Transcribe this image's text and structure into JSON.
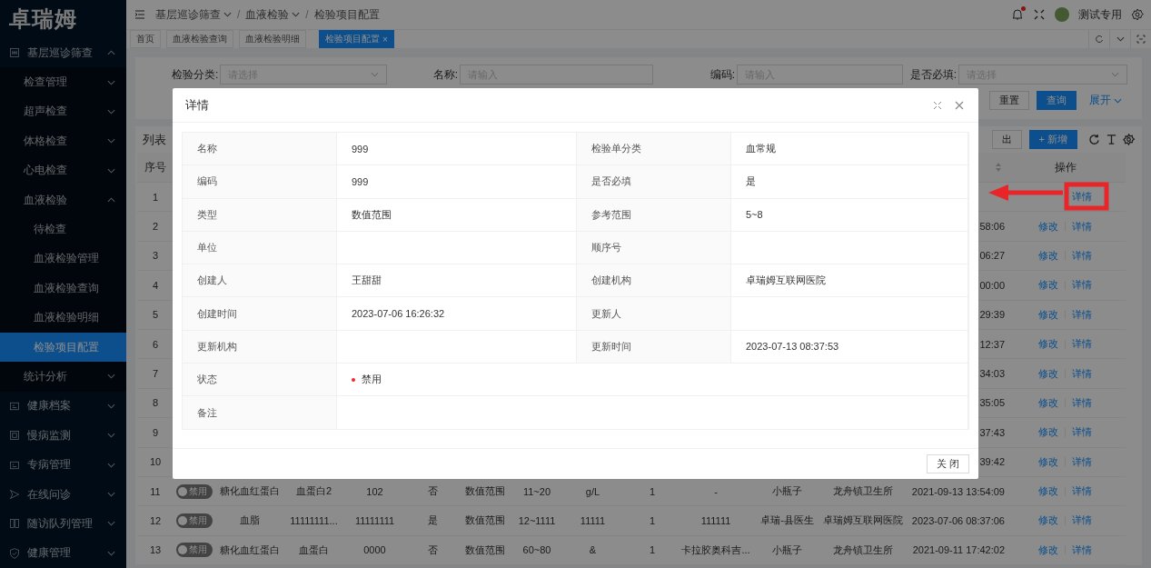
{
  "sidebar": {
    "logo": "卓瑞姆",
    "items": [
      {
        "label": "基层巡诊筛查",
        "expanded": true,
        "selected": false,
        "children": [
          {
            "label": "检查管理",
            "expanded": false,
            "selected": false
          },
          {
            "label": "超声检查",
            "expanded": false,
            "selected": false
          },
          {
            "label": "体格检查",
            "expanded": false,
            "selected": false
          },
          {
            "label": "心电检查",
            "expanded": false,
            "selected": false
          },
          {
            "label": "血液检验",
            "expanded": true,
            "selected": false,
            "children": [
              {
                "label": "待检查",
                "selected": false
              },
              {
                "label": "血液检验管理",
                "selected": false
              },
              {
                "label": "血液检验查询",
                "selected": false
              },
              {
                "label": "血液检验明细",
                "selected": false
              },
              {
                "label": "检验项目配置",
                "selected": true
              }
            ]
          },
          {
            "label": "统计分析",
            "expanded": false,
            "selected": false
          }
        ]
      },
      {
        "label": "健康档案",
        "expanded": false,
        "selected": false
      },
      {
        "label": "慢病监测",
        "expanded": false,
        "selected": false
      },
      {
        "label": "专病管理",
        "expanded": false,
        "selected": false
      },
      {
        "label": "在线问诊",
        "expanded": false,
        "selected": false
      },
      {
        "label": "随访队列管理",
        "expanded": false,
        "selected": false
      },
      {
        "label": "健康管理",
        "expanded": false,
        "selected": false
      }
    ]
  },
  "header": {
    "breadcrumb": [
      {
        "label": "基层巡诊筛查",
        "dropdown": true
      },
      {
        "label": "血液检验",
        "dropdown": true
      },
      {
        "label": "检验项目配置",
        "dropdown": false
      }
    ],
    "separator": "/",
    "notification_dot": true,
    "user": "测试专用"
  },
  "tabs": [
    {
      "label": "首页",
      "selected": false,
      "closable": false
    },
    {
      "label": "血液检验查询",
      "selected": false,
      "closable": false
    },
    {
      "label": "血液检验明细",
      "selected": false,
      "closable": false
    },
    {
      "label": "检验项目配置",
      "selected": true,
      "closable": true
    }
  ],
  "tab_close": "×",
  "filters": [
    {
      "label": "检验分类:",
      "kind": "select",
      "placeholder": "请选择"
    },
    {
      "label": "名称:",
      "kind": "input",
      "placeholder": "请输入"
    },
    {
      "label": "编码:",
      "kind": "input",
      "placeholder": "请输入"
    },
    {
      "label": "是否必填:",
      "kind": "select",
      "placeholder": "请选择"
    }
  ],
  "filter_buttons": {
    "reset": "重置",
    "search": "查询",
    "expand": "展开"
  },
  "table": {
    "title": "列表",
    "export_button": "出",
    "add_button": "+ 新增",
    "columns": {
      "no": "序号",
      "actions": "操作"
    },
    "rows": [
      {
        "no": "1",
        "actions": [
          {
            "kind": "detail",
            "label": "详情"
          }
        ]
      },
      {
        "no": "2",
        "column_14": "58:06",
        "actions": [
          {
            "kind": "edit",
            "label": "修改"
          },
          {
            "kind": "detail",
            "label": "详情"
          }
        ]
      },
      {
        "no": "3",
        "column_14": "06:27",
        "actions": [
          {
            "kind": "edit",
            "label": "修改"
          },
          {
            "kind": "detail",
            "label": "详情"
          }
        ]
      },
      {
        "no": "4",
        "column_14": "00:00",
        "actions": [
          {
            "kind": "edit",
            "label": "修改"
          },
          {
            "kind": "detail",
            "label": "详情"
          }
        ]
      },
      {
        "no": "5",
        "column_14": "29:39",
        "actions": [
          {
            "kind": "edit",
            "label": "修改"
          },
          {
            "kind": "detail",
            "label": "详情"
          }
        ]
      },
      {
        "no": "6",
        "column_14": "12:37",
        "actions": [
          {
            "kind": "edit",
            "label": "修改"
          },
          {
            "kind": "detail",
            "label": "详情"
          }
        ]
      },
      {
        "no": "7",
        "column_14": "34:03",
        "actions": [
          {
            "kind": "edit",
            "label": "修改"
          },
          {
            "kind": "detail",
            "label": "详情"
          }
        ]
      },
      {
        "no": "8",
        "column_14": "35:05",
        "actions": [
          {
            "kind": "edit",
            "label": "修改"
          },
          {
            "kind": "detail",
            "label": "详情"
          }
        ]
      },
      {
        "no": "9",
        "column_14": "37:43",
        "actions": [
          {
            "kind": "edit",
            "label": "修改"
          },
          {
            "kind": "detail",
            "label": "详情"
          }
        ]
      },
      {
        "no": "10",
        "column_14": "39:42",
        "actions": [
          {
            "kind": "edit",
            "label": "修改"
          },
          {
            "kind": "detail",
            "label": "详情"
          }
        ]
      },
      {
        "no": "11",
        "status": {
          "on": false,
          "label": "禁用"
        },
        "column_3": "糖化血红蛋白",
        "column_4": "血蛋白2",
        "column_5": "102",
        "column_6": "否",
        "column_7": "数值范围",
        "column_8": "11~20",
        "column_9": "g/L",
        "column_10": "1",
        "column_11": "-",
        "column_12": "小瓶子",
        "column_13": "龙舟镇卫生所",
        "column_14": "2021-09-13 13:54:09",
        "actions": [
          {
            "kind": "edit",
            "label": "修改"
          },
          {
            "kind": "detail",
            "label": "详情"
          }
        ]
      },
      {
        "no": "12",
        "status": {
          "on": false,
          "label": "禁用"
        },
        "column_3": "血脂",
        "column_4": "11111111...",
        "column_5": "11111111",
        "column_6": "是",
        "column_7": "数值范围",
        "column_8": "12~1111",
        "column_9": "11111",
        "column_10": "1",
        "column_11": "111111",
        "column_12": "卓瑞-县医生",
        "column_13": "卓瑞姆互联网医院",
        "column_14": "2023-07-06 08:37:06",
        "actions": [
          {
            "kind": "edit",
            "label": "修改"
          },
          {
            "kind": "detail",
            "label": "详情"
          }
        ]
      },
      {
        "no": "13",
        "status": {
          "on": false,
          "label": "禁用"
        },
        "column_3": "糖化血红蛋白",
        "column_4": "血蛋白",
        "column_5": "0000",
        "column_6": "否",
        "column_7": "数值范围",
        "column_8": "60~80",
        "column_9": "&",
        "column_10": "1",
        "column_11": "卡拉胶奥科吉...",
        "column_12": "小瓶子",
        "column_13": "龙舟镇卫生所",
        "column_14": "2021-09-11 17:42:02",
        "actions": [
          {
            "kind": "edit",
            "label": "修改"
          },
          {
            "kind": "detail",
            "label": "详情"
          }
        ]
      }
    ]
  },
  "modal": {
    "title": "详情",
    "close_button": "关 闭",
    "rows": [
      [
        {
          "label": "名称",
          "value": "999"
        },
        {
          "label": "检验单分类",
          "value": "血常规"
        }
      ],
      [
        {
          "label": "编码",
          "value": "999"
        },
        {
          "label": "是否必填",
          "value": "是"
        }
      ],
      [
        {
          "label": "类型",
          "value": "数值范围"
        },
        {
          "label": "参考范围",
          "value": "5~8"
        }
      ],
      [
        {
          "label": "单位"
        },
        {
          "label": "顺序号"
        }
      ],
      [
        {
          "label": "创建人",
          "value": "王甜甜"
        },
        {
          "label": "创建机构",
          "value": "卓瑞姆互联网医院"
        }
      ],
      [
        {
          "label": "创建时间",
          "value": "2023-07-06 16:26:32"
        },
        {
          "label": "更新人"
        }
      ],
      [
        {
          "label": "更新机构"
        },
        {
          "label": "更新时间",
          "value": "2023-07-13 08:37:53"
        }
      ],
      [
        {
          "label": "状态",
          "value": "禁用",
          "kind": "status",
          "color": "#f5222d"
        }
      ],
      [
        {
          "label": "备注"
        }
      ]
    ]
  }
}
